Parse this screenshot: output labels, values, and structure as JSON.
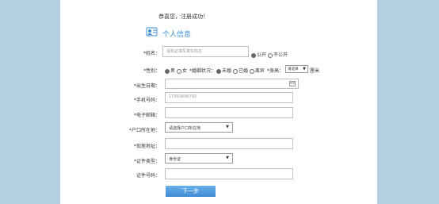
{
  "success_msg": "恭喜您，注册成功！",
  "section_title": "个人信息",
  "name": {
    "label": "*姓名：",
    "placeholder": "请务必填写真实姓名",
    "public": "公开",
    "private": "不公开"
  },
  "gender": {
    "label": "*性别：",
    "options": [
      "男",
      "女"
    ]
  },
  "marital": {
    "label": "*婚姻状况：",
    "options": [
      "未婚",
      "已婚",
      "离异"
    ]
  },
  "height": {
    "label": "*身高：",
    "value": "请选择",
    "unit": "厘米"
  },
  "birth": {
    "label": "*出生日期："
  },
  "phone": {
    "label": "*手机号码：",
    "value": "17350898793"
  },
  "email": {
    "label": "*电子邮箱："
  },
  "hukou": {
    "label": "*户口所在地：",
    "value": "请选择户口所在地"
  },
  "address": {
    "label": "*现居地址："
  },
  "idtype": {
    "label": "*证件类型：",
    "value": "身份证"
  },
  "idnum": {
    "label": "证件号码："
  },
  "next_button": "下一步"
}
